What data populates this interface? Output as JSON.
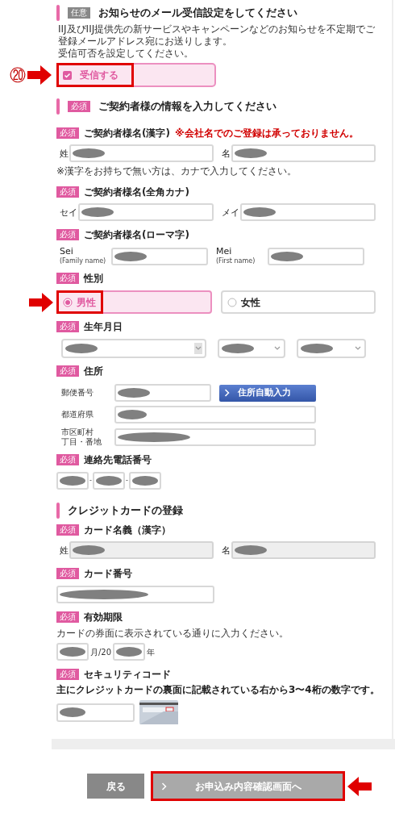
{
  "notice_section": {
    "tag": {
      "kind": "optional",
      "label": "任意"
    },
    "title": "お知らせのメール受信設定をしてください",
    "description": [
      "IIJ及びIIJ提供先の新サービスやキャンペーンなどのお知らせを不定期でご登録メールアドレス宛にお送りします。",
      "受信可否を設定してください。"
    ],
    "checkbox": {
      "label": "受信する",
      "checked": true,
      "highlighted": true,
      "step": "⑳"
    }
  },
  "contract_section": {
    "tag": {
      "kind": "required",
      "label": "必須"
    },
    "title": "ご契約者様の情報を入力してください",
    "fields": [
      {
        "kind": "name_pair",
        "tag": "必須",
        "label": "ご契約者様名(漢字)",
        "note": "※会社名でのご登録は承っておりません。",
        "inputs": [
          {
            "label": "姓"
          },
          {
            "label": "名"
          }
        ],
        "hint": "※漢字をお持ちで無い方は、カナで入力してください。"
      },
      {
        "kind": "name_pair",
        "tag": "必須",
        "label": "ご契約者様名(全角カナ)",
        "inputs": [
          {
            "label": "セイ"
          },
          {
            "label": "メイ"
          }
        ]
      },
      {
        "kind": "name_pair",
        "tag": "必須",
        "label": "ご契約者様名(ローマ字)",
        "inputs": [
          {
            "label": "Sei",
            "sublabel": "(Family name)"
          },
          {
            "label": "Mei",
            "sublabel": "(First name)"
          }
        ]
      },
      {
        "kind": "radio_group",
        "tag": "必須",
        "label": "性別",
        "options": [
          {
            "label": "男性",
            "selected": true,
            "highlighted": true
          },
          {
            "label": "女性",
            "selected": false,
            "highlighted": false
          }
        ]
      },
      {
        "kind": "select_row",
        "tag": "必須",
        "label": "生年月日"
      },
      {
        "kind": "address",
        "tag": "必須",
        "label": "住所",
        "rows": [
          {
            "lines": [
              "郵便番号"
            ],
            "button": "住所自動入力"
          },
          {
            "lines": [
              "都道府県"
            ]
          },
          {
            "lines": [
              "市区町村",
              "丁目・番地"
            ]
          }
        ]
      },
      {
        "kind": "phone",
        "tag": "必須",
        "label": "連絡先電話番号",
        "separator": "-"
      }
    ]
  },
  "card_section": {
    "title": "クレジットカードの登録",
    "fields": [
      {
        "kind": "name_pair",
        "tag": "必須",
        "label": "カード名義（漢字）",
        "disabled": true,
        "inputs": [
          {
            "label": "姓"
          },
          {
            "label": "名"
          }
        ]
      },
      {
        "kind": "single",
        "tag": "必須",
        "label": "カード番号"
      },
      {
        "kind": "expiry",
        "tag": "必須",
        "label": "有効期限",
        "hint": "カードの券面に表示されている通りに入力ください。",
        "parts": [
          {
            "kind": "input"
          },
          {
            "kind": "text",
            "text": "月/20"
          },
          {
            "kind": "input"
          },
          {
            "kind": "text",
            "text": "年"
          }
        ]
      },
      {
        "kind": "security",
        "tag": "必須",
        "label": "セキュリティコード",
        "hint": "主にクレジットカードの裏面に記載されている右から3〜4桁の数字です。"
      }
    ]
  },
  "buttons": [
    {
      "kind": "back",
      "label": "戻る",
      "highlighted": false
    },
    {
      "kind": "next",
      "label": "お申込み内容確認画面へ",
      "highlighted": true
    }
  ]
}
